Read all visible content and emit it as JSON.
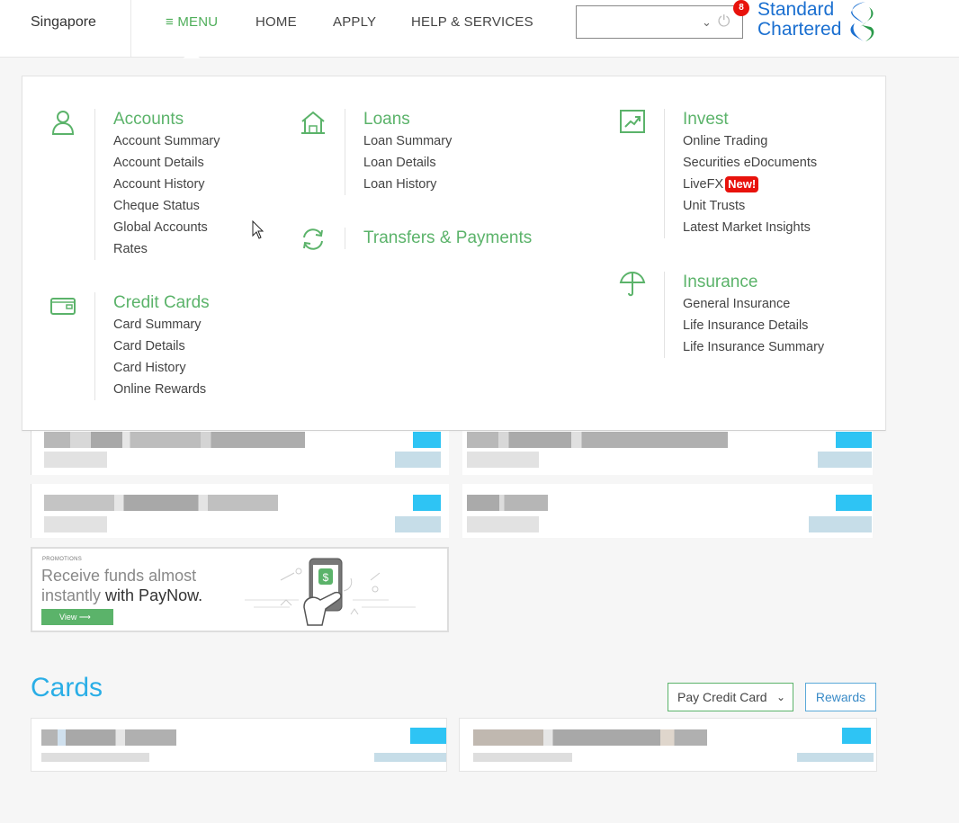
{
  "header": {
    "country": "Singapore",
    "nav": {
      "menu": "≡ MENU",
      "home": "HOME",
      "apply": "APPLY",
      "help": "HELP & SERVICES"
    },
    "account_select_value": "",
    "notification_count": "8",
    "brand_line1": "Standard",
    "brand_line2": "Chartered"
  },
  "menu": {
    "accounts": {
      "title": "Accounts",
      "items": [
        "Account Summary",
        "Account Details",
        "Account History",
        "Cheque Status",
        "Global Accounts",
        "Rates"
      ]
    },
    "credit_cards": {
      "title": "Credit Cards",
      "items": [
        "Card Summary",
        "Card Details",
        "Card History",
        "Online Rewards"
      ]
    },
    "loans": {
      "title": "Loans",
      "items": [
        "Loan Summary",
        "Loan Details",
        "Loan History"
      ]
    },
    "transfers": {
      "title": "Transfers & Payments"
    },
    "invest": {
      "title": "Invest",
      "items": [
        "Online Trading",
        "Securities eDocuments",
        "LiveFX",
        "Unit Trusts",
        "Latest Market Insights"
      ],
      "new_badge": "New!"
    },
    "insurance": {
      "title": "Insurance",
      "items": [
        "General Insurance",
        "Life Insurance Details",
        "Life Insurance Summary"
      ]
    }
  },
  "promo": {
    "tag": "PROMOTIONS",
    "line1": "Receive funds almost",
    "line2_prefix": "instantly ",
    "line2_bold": "with PayNow.",
    "button": "View ⟶"
  },
  "cards_section": {
    "heading": "Cards",
    "pay_button": "Pay Credit Card",
    "rewards_button": "Rewards"
  },
  "colors": {
    "accent_green": "#5bb36a",
    "brand_blue": "#1a6fd0",
    "cards_blue": "#2aaee6",
    "badge_red": "#e8120c"
  }
}
